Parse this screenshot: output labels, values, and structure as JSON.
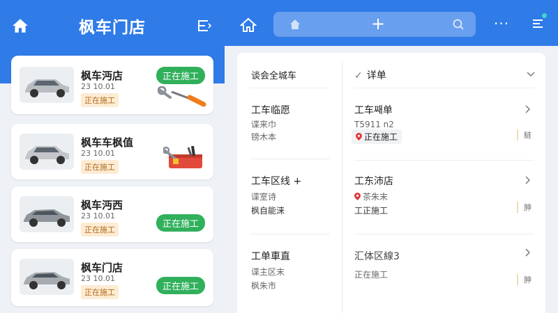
{
  "left_panel": {
    "title": "枫车门店",
    "cards": [
      {
        "name": "枫车沔店",
        "date": "23 10.01",
        "tag": "正在施工",
        "status": "正在施工"
      },
      {
        "name": "枫车车枫值",
        "date": "23 10.01",
        "tag": "正在施工"
      },
      {
        "name": "枫车沔西",
        "date": "23 10.01",
        "tag": "正在施工",
        "status": "正在施工"
      },
      {
        "name": "枫车门店",
        "date": "23 10.01",
        "tag": "正在施工",
        "status": "正在施工"
      }
    ]
  },
  "right_panel": {
    "search": {
      "plus": "+"
    },
    "more": "···",
    "left_column": {
      "header": "谈会全城车",
      "items": [
        {
          "title": "工车临愿",
          "line1": "谍来巾",
          "line2": "镑木本"
        },
        {
          "title": "工车区线 +",
          "line1": "谍室诗",
          "line2": "枫自能涞"
        },
        {
          "title": "工单車直",
          "line1": "谍主区末",
          "line2": "枫朱市"
        }
      ]
    },
    "right_column": {
      "header": "详单",
      "check": "✓",
      "rows": [
        {
          "title": "工车째单",
          "line1": "T5911 n2",
          "status": "正在施工",
          "side": "鲢"
        },
        {
          "title": "工东沛店",
          "line1": "茶朱末",
          "line2": "工正施工",
          "side": "胂"
        },
        {
          "title": "汇体区線3",
          "line1": "正在施工",
          "side": "胂"
        }
      ]
    }
  },
  "colors": {
    "brand_blue": "#2f7be8",
    "status_green": "#31b05c",
    "tag_orange": "#fdebd3",
    "pin_red": "#e0393e"
  }
}
